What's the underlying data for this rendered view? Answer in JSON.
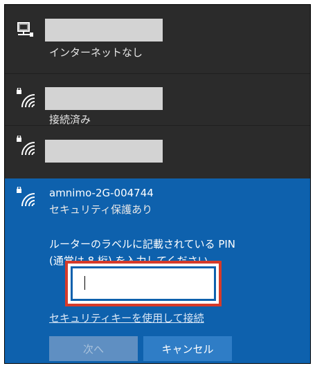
{
  "networks": [
    {
      "status": "インターネットなし",
      "icon": "ethernet-icon"
    },
    {
      "status": "接続済み",
      "icon": "wifi-secured-icon"
    },
    {
      "status": "",
      "icon": "wifi-secured-icon"
    }
  ],
  "active_network": {
    "ssid": "amnimo-2G-004744",
    "security": "セキュリティ保護あり",
    "icon": "wifi-secured-icon",
    "prompt_line1": "ルーターのラベルに記載されている PIN",
    "prompt_line2": "(通常は 8 桁) を入力してください",
    "pin_value": "",
    "security_key_link": "セキュリティキーを使用して接続",
    "next_label": "次へ",
    "cancel_label": "キャンセル"
  },
  "colors": {
    "panel_bg": "#2b2b2b",
    "active_bg": "#0e61ad",
    "highlight": "#d63a2a",
    "redaction": "#d3d3d3"
  }
}
